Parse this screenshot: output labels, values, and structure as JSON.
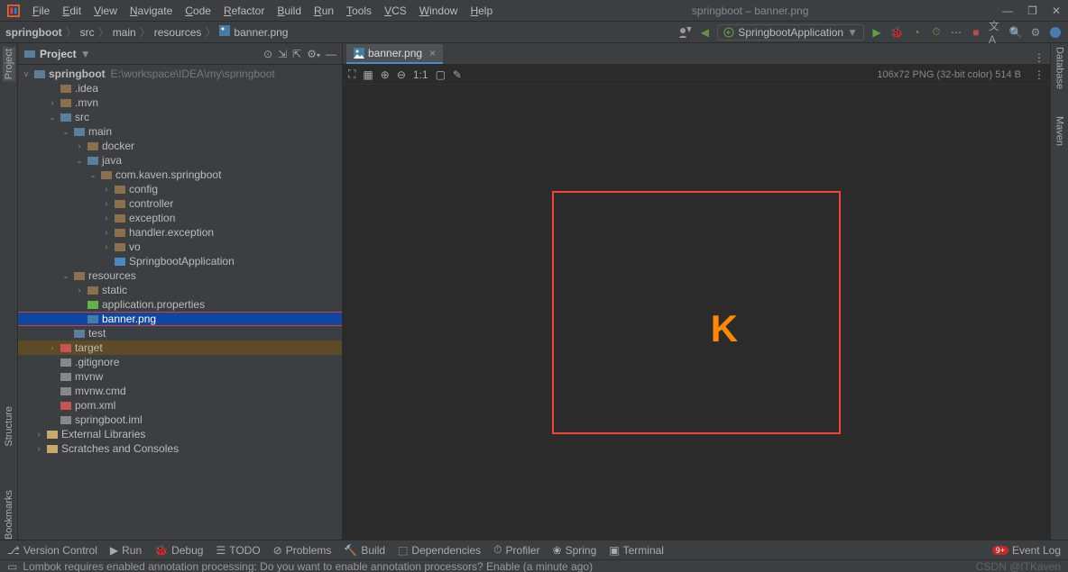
{
  "window": {
    "title": "springboot – banner.png",
    "minimize": "—",
    "maximize": "❐",
    "close": "✕"
  },
  "menu": [
    "File",
    "Edit",
    "View",
    "Navigate",
    "Code",
    "Refactor",
    "Build",
    "Run",
    "Tools",
    "VCS",
    "Window",
    "Help"
  ],
  "breadcrumbs": [
    "springboot",
    "src",
    "main",
    "resources",
    "banner.png"
  ],
  "runConfig": "SpringbootApplication",
  "projectTool": {
    "title": "Project"
  },
  "tree": {
    "root": "springboot",
    "rootPath": "E:\\workspace\\IDEA\\my\\springboot",
    "nodes": [
      {
        "d": 1,
        "a": "",
        "t": "dir",
        "l": ".idea"
      },
      {
        "d": 1,
        "a": ">",
        "t": "dir",
        "l": ".mvn"
      },
      {
        "d": 1,
        "a": "v",
        "t": "mod",
        "l": "src"
      },
      {
        "d": 2,
        "a": "v",
        "t": "mod",
        "l": "main"
      },
      {
        "d": 3,
        "a": ">",
        "t": "dir",
        "l": "docker"
      },
      {
        "d": 3,
        "a": "v",
        "t": "mod",
        "l": "java"
      },
      {
        "d": 4,
        "a": "v",
        "t": "pkg",
        "l": "com.kaven.springboot"
      },
      {
        "d": 5,
        "a": ">",
        "t": "pkg",
        "l": "config"
      },
      {
        "d": 5,
        "a": ">",
        "t": "pkg",
        "l": "controller"
      },
      {
        "d": 5,
        "a": ">",
        "t": "pkg",
        "l": "exception"
      },
      {
        "d": 5,
        "a": ">",
        "t": "pkg",
        "l": "handler.exception"
      },
      {
        "d": 5,
        "a": ">",
        "t": "pkg",
        "l": "vo"
      },
      {
        "d": 5,
        "a": "",
        "t": "cls",
        "l": "SpringbootApplication"
      },
      {
        "d": 2,
        "a": "v",
        "t": "res",
        "l": "resources"
      },
      {
        "d": 3,
        "a": ">",
        "t": "dir",
        "l": "static"
      },
      {
        "d": 3,
        "a": "",
        "t": "prop",
        "l": "application.properties"
      },
      {
        "d": 3,
        "a": "",
        "t": "img",
        "l": "banner.png",
        "sel": true
      },
      {
        "d": 2,
        "a": "",
        "t": "mod",
        "l": "test"
      },
      {
        "d": 1,
        "a": ">",
        "t": "tgt",
        "l": "target",
        "hl": true
      },
      {
        "d": 1,
        "a": "",
        "t": "file",
        "l": ".gitignore"
      },
      {
        "d": 1,
        "a": "",
        "t": "file",
        "l": "mvnw"
      },
      {
        "d": 1,
        "a": "",
        "t": "file",
        "l": "mvnw.cmd"
      },
      {
        "d": 1,
        "a": "",
        "t": "mvn",
        "l": "pom.xml"
      },
      {
        "d": 1,
        "a": "",
        "t": "file",
        "l": "springboot.iml"
      },
      {
        "d": 0,
        "a": ">",
        "t": "lib",
        "l": "External Libraries"
      },
      {
        "d": 0,
        "a": ">",
        "t": "scr",
        "l": "Scratches and Consoles"
      }
    ]
  },
  "tab": {
    "name": "banner.png"
  },
  "imageToolbar": {
    "ratio": "1:1"
  },
  "imageInfo": "106x72 PNG (32-bit color) 514 B",
  "imageGlyph": "K",
  "sidebars": {
    "left": [
      "Project",
      "Bookmarks",
      "Structure"
    ],
    "right": [
      "Database",
      "Maven"
    ]
  },
  "bottomTools": [
    "Version Control",
    "Run",
    "Debug",
    "TODO",
    "Problems",
    "Build",
    "Dependencies",
    "Profiler",
    "Spring",
    "Terminal"
  ],
  "eventLog": "Event Log",
  "eventBadge": "9+",
  "status": "Lombok requires enabled annotation processing: Do you want to enable annotation processors? Enable (a minute ago)",
  "watermark": "CSDN @ITKaven"
}
